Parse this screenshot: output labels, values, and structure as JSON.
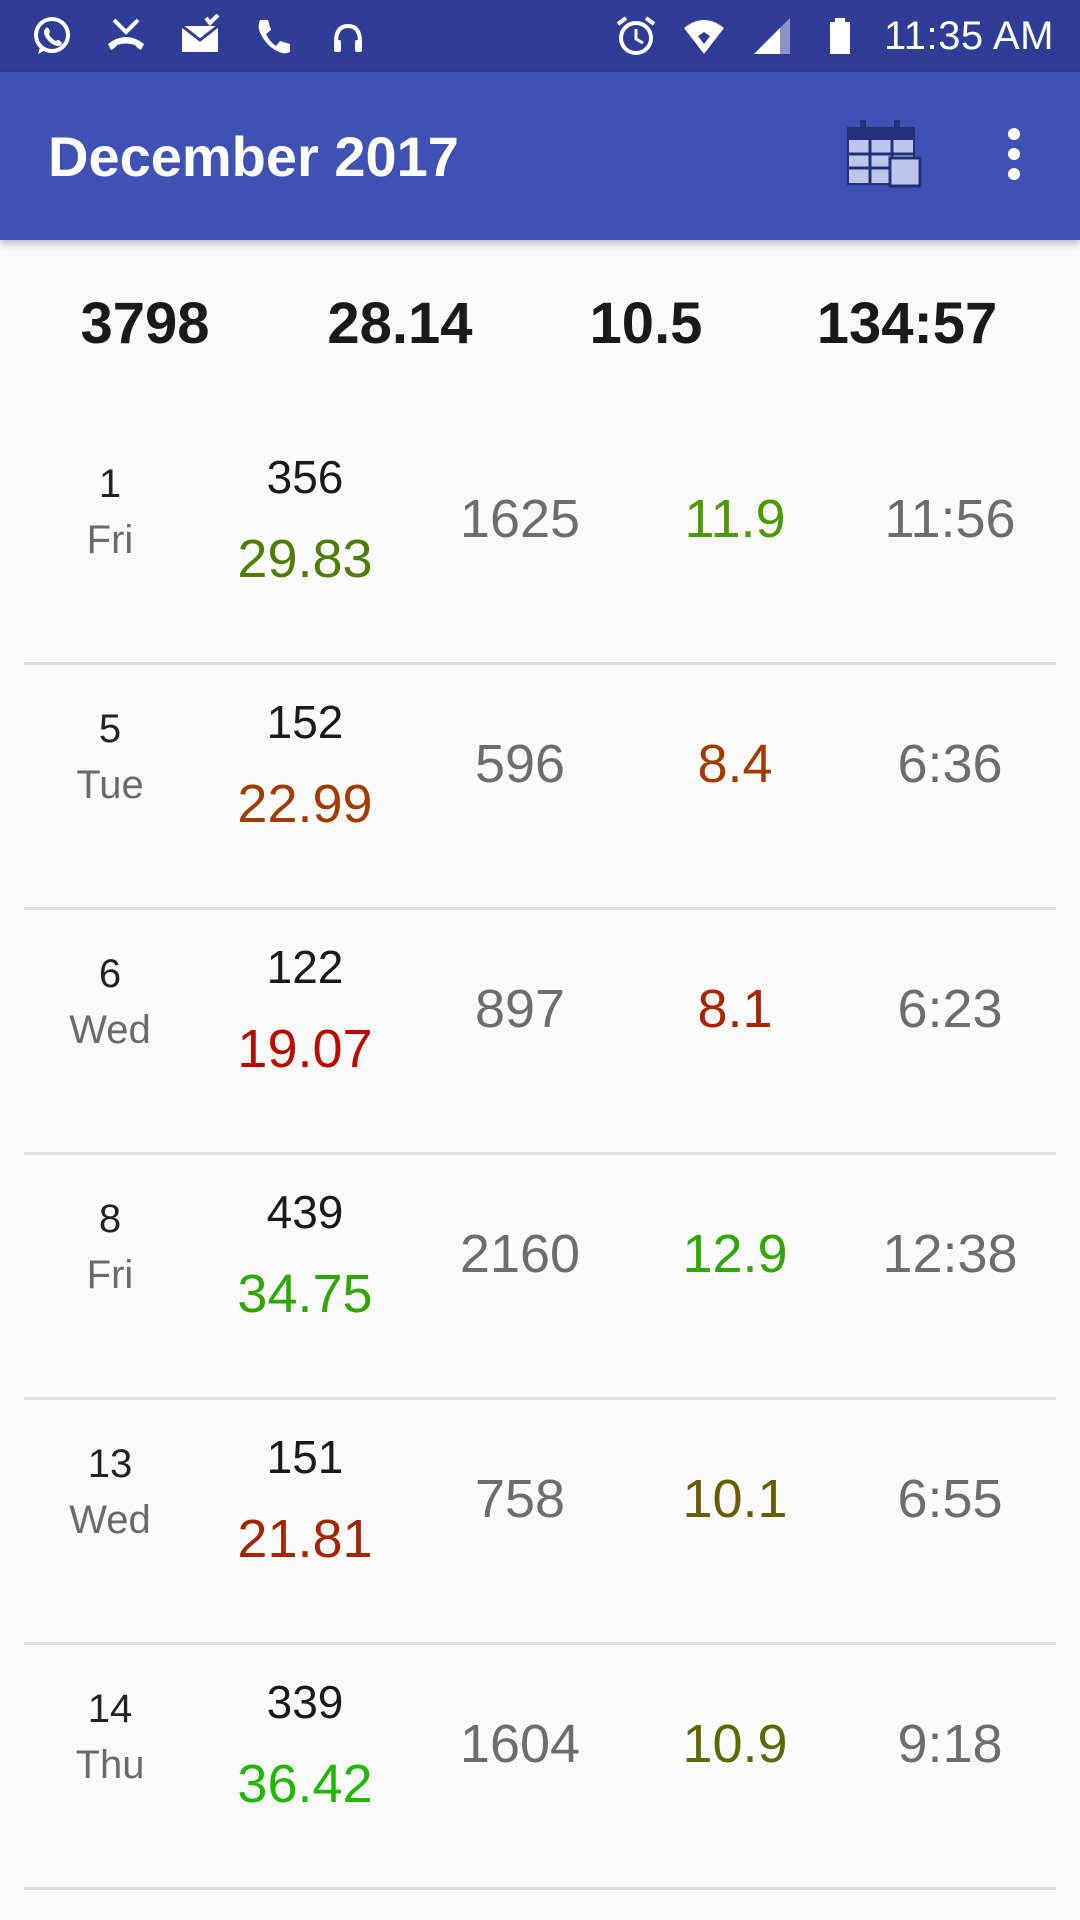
{
  "status_bar": {
    "time": "11:35 AM",
    "left_icons": [
      "whatsapp-icon",
      "missed-call-icon",
      "mail-icon",
      "phone-icon",
      "headset-icon"
    ],
    "right_icons": [
      "alarm-icon",
      "wifi-icon",
      "cell-signal-icon",
      "battery-icon"
    ]
  },
  "app_bar": {
    "title": "December 2017",
    "calendar_icon": "calendar-icon",
    "menu_icon": "more-vert-icon",
    "color": "#3f51b5"
  },
  "summary": {
    "total": "3798",
    "avg_score": "28.14",
    "avg_speed": "10.5",
    "total_time": "134:57"
  },
  "rows": [
    {
      "day": "1",
      "weekday": "Fri",
      "count": "356",
      "score": "29.83",
      "score_color": "#4f7d00",
      "value": "1625",
      "speed": "11.9",
      "speed_color": "#4a9a00",
      "time": "11:56"
    },
    {
      "day": "5",
      "weekday": "Tue",
      "count": "152",
      "score": "22.99",
      "score_color": "#a33a00",
      "value": "596",
      "speed": "8.4",
      "speed_color": "#a33a00",
      "time": "6:36"
    },
    {
      "day": "6",
      "weekday": "Wed",
      "count": "122",
      "score": "19.07",
      "score_color": "#bb0a00",
      "value": "897",
      "speed": "8.1",
      "speed_color": "#a82400",
      "time": "6:23"
    },
    {
      "day": "8",
      "weekday": "Fri",
      "count": "439",
      "score": "34.75",
      "score_color": "#2ea800",
      "value": "2160",
      "speed": "12.9",
      "speed_color": "#2ea800",
      "time": "12:38"
    },
    {
      "day": "13",
      "weekday": "Wed",
      "count": "151",
      "score": "21.81",
      "score_color": "#a32600",
      "value": "758",
      "speed": "10.1",
      "speed_color": "#6b5a00",
      "time": "6:55"
    },
    {
      "day": "14",
      "weekday": "Thu",
      "count": "339",
      "score": "36.42",
      "score_color": "#1fb800",
      "value": "1604",
      "speed": "10.9",
      "speed_color": "#5c6800",
      "time": "9:18"
    }
  ]
}
